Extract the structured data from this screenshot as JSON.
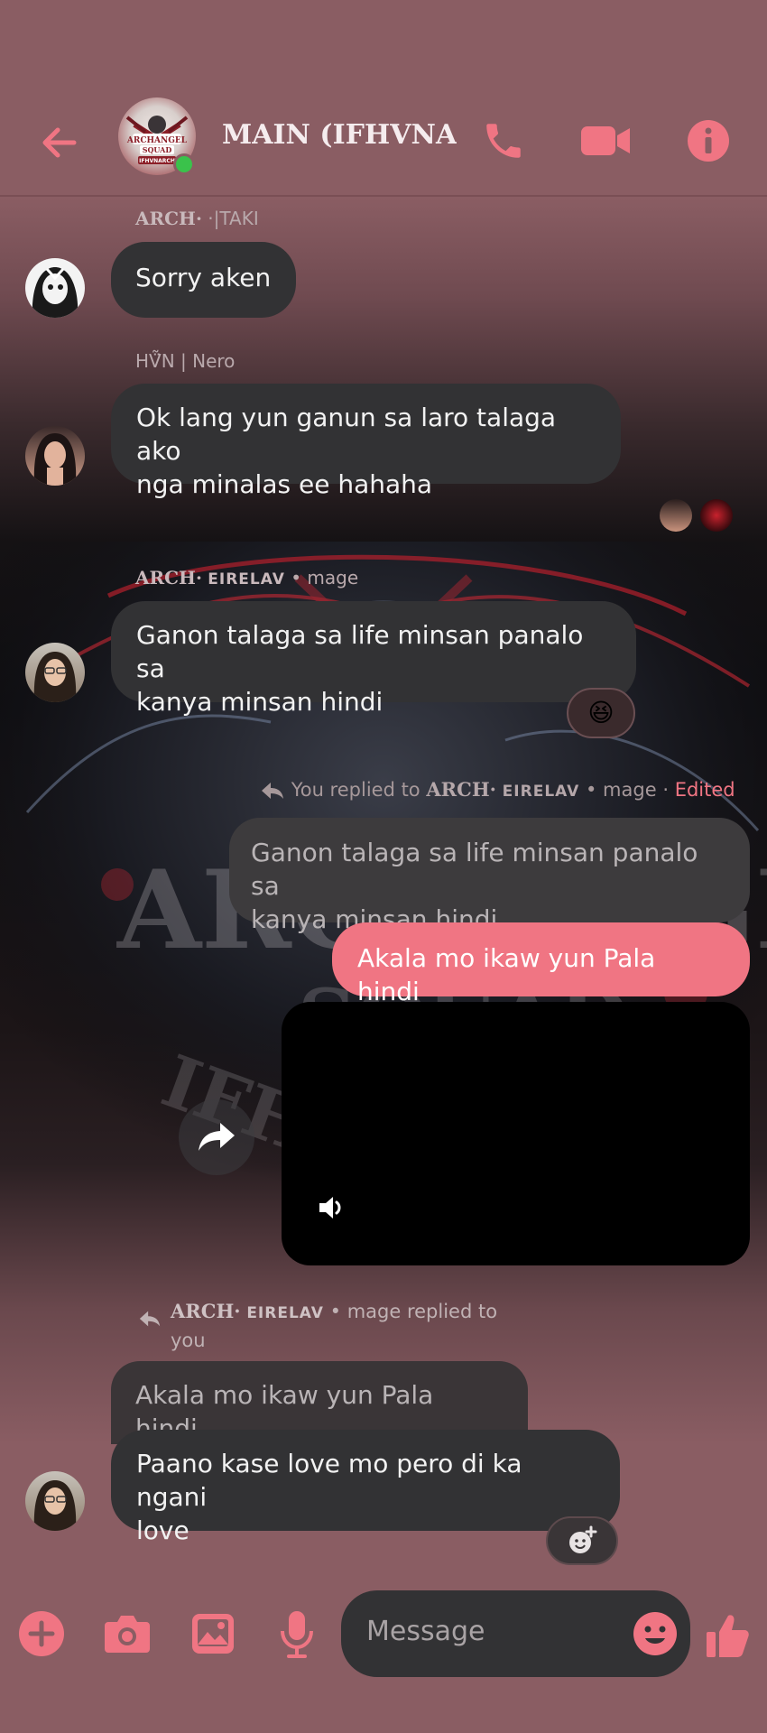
{
  "header": {
    "back_icon": "arrow-left-icon",
    "group_name": "MAIN (IFHVNA...",
    "group_avatar_text": [
      "ARCHANGEL",
      "SQUAD",
      "IFHVNARCH"
    ],
    "online": true,
    "call_icon": "phone-icon",
    "video_icon": "video-camera-icon",
    "info_icon": "info-icon"
  },
  "messages": [
    {
      "sender_prefix": "ARCH·",
      "sender_name": "·|TAKI",
      "text": "Sorry aken"
    },
    {
      "sender_name": "HṼ̈N | Nero",
      "lines": [
        "Ok lang yun ganun sa laro talaga ako",
        "nga minalas ee hahaha"
      ]
    },
    {
      "sender_prefix": "ARCH·",
      "sender_name_caps": "EIRELAV",
      "sender_suffix": "• mage",
      "lines": [
        "Ganon talaga sa life minsan panalo sa",
        "kanya minsan hindi"
      ],
      "reaction": "😆"
    },
    {
      "reply_prefix": "You replied to",
      "reply_to_prefix": "ARCH·",
      "reply_to_caps": "EIRELAV",
      "reply_to_suffix": "• mage ·",
      "edited_label": "Edited",
      "quote_lines": [
        "Ganon talaga sa life minsan panalo sa",
        "kanya minsan hindi"
      ],
      "text": "Akala mo ikaw yun Pala hindi"
    },
    {
      "type": "video",
      "sound_icon": "speaker-icon",
      "forward_icon": "share-forward-icon"
    },
    {
      "reply_prefix": "ARCH·",
      "reply_caps": "EIRELAV",
      "reply_suffix": "• mage replied to",
      "reply_you": "you",
      "quote_text": "Akala mo ikaw yun Pala hindi",
      "lines": [
        "Paano kase love mo pero di ka ngani",
        "love"
      ],
      "add_reaction_icon": "add-reaction-icon"
    }
  ],
  "composer": {
    "placeholder": "Message",
    "plus_icon": "plus-circle-icon",
    "camera_icon": "camera-icon",
    "gallery_icon": "image-icon",
    "mic_icon": "microphone-icon",
    "emoji_icon": "smiley-icon",
    "like_icon": "thumbs-up-icon"
  },
  "colors": {
    "accent": "#f07583",
    "bubble_dark": "#323234",
    "background": "#8a5d63",
    "online": "#3ac24b"
  }
}
